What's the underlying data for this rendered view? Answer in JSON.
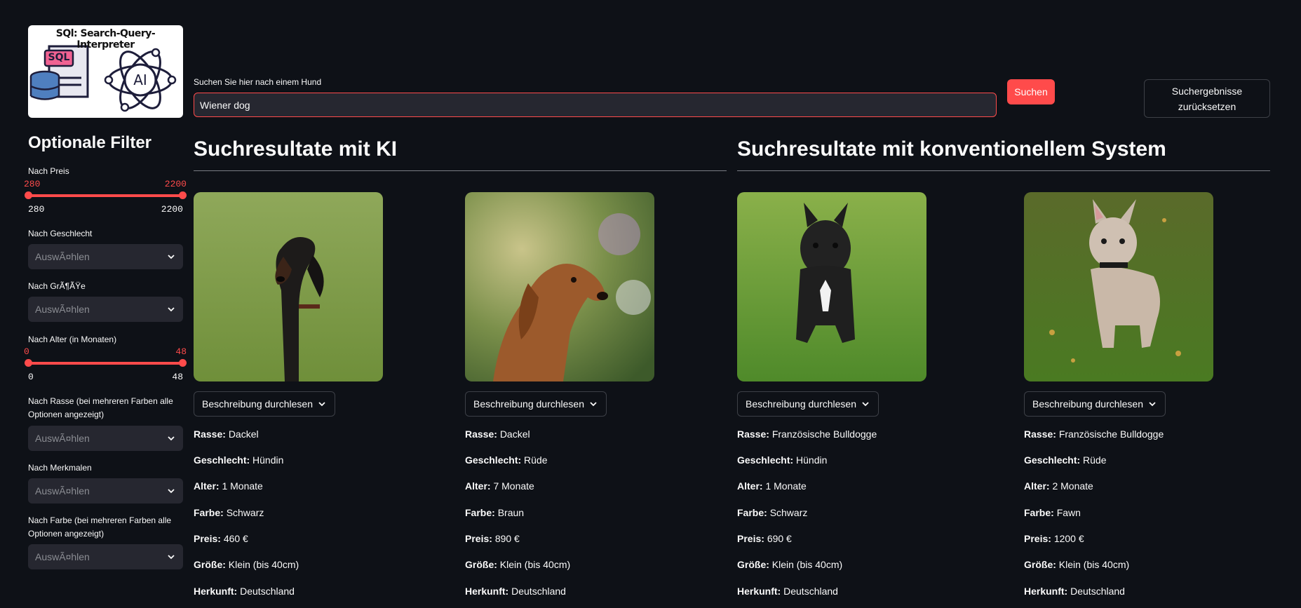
{
  "logo": {
    "title": "SQl: Search-Query-Interpreter",
    "badge_sql": "SQL",
    "badge_ai": "AI"
  },
  "search": {
    "label": "Suchen Sie hier nach einem Hund",
    "value": "Wiener dog",
    "button": "Suchen",
    "reset": "Suchergebnisse zurücksetzen"
  },
  "filters": {
    "title": "Optionale Filter",
    "price": {
      "label": "Nach Preis",
      "min": "280",
      "max": "2200",
      "low": "280",
      "high": "2200"
    },
    "gender": {
      "label": "Nach Geschlecht",
      "placeholder": "AuswÃ¤hlen"
    },
    "size": {
      "label": "Nach GrÃ¶ÃŸe",
      "placeholder": "AuswÃ¤hlen"
    },
    "age": {
      "label": "Nach Alter (in Monaten)",
      "min": "0",
      "max": "48",
      "low": "0",
      "high": "48"
    },
    "breed": {
      "label": "Nach Rasse (bei mehreren Farben alle Optionen angezeigt)",
      "placeholder": "AuswÃ¤hlen"
    },
    "traits": {
      "label": "Nach Merkmalen",
      "placeholder": "AuswÃ¤hlen"
    },
    "color": {
      "label": "Nach Farbe (bei mehreren Farben alle Optionen angezeigt)",
      "placeholder": "AuswÃ¤hlen"
    }
  },
  "sections": {
    "ai": "Suchresultate mit KI",
    "conventional": "Suchresultate mit konventionellem System"
  },
  "field_labels": {
    "breed": "Rasse:",
    "gender": "Geschlecht:",
    "age": "Alter:",
    "color": "Farbe:",
    "price": "Preis:",
    "size": "Größe:",
    "origin": "Herkunft:"
  },
  "expander_label": "Beschreibung durchlesen",
  "cards": [
    {
      "breed": "Dackel",
      "gender": "Hündin",
      "age": "1 Monate",
      "color": "Schwarz",
      "price": "460 €",
      "size": "Klein (bis 40cm)",
      "origin": "Deutschland",
      "image": "black-dachshund"
    },
    {
      "breed": "Dackel",
      "gender": "Rüde",
      "age": "7 Monate",
      "color": "Braun",
      "price": "890 €",
      "size": "Klein (bis 40cm)",
      "origin": "Deutschland",
      "image": "brown-dachshund"
    },
    {
      "breed": "Französische Bulldogge",
      "gender": "Hündin",
      "age": "1 Monate",
      "color": "Schwarz",
      "price": "690 €",
      "size": "Klein (bis 40cm)",
      "origin": "Deutschland",
      "image": "black-french-bulldog"
    },
    {
      "breed": "Französische Bulldogge",
      "gender": "Rüde",
      "age": "2 Monate",
      "color": "Fawn",
      "price": "1200 €",
      "size": "Klein (bis 40cm)",
      "origin": "Deutschland",
      "image": "fawn-french-bulldog"
    }
  ],
  "colors": {
    "accent": "#ff4b4b",
    "background": "#0e1117",
    "input_bg": "#262730"
  }
}
